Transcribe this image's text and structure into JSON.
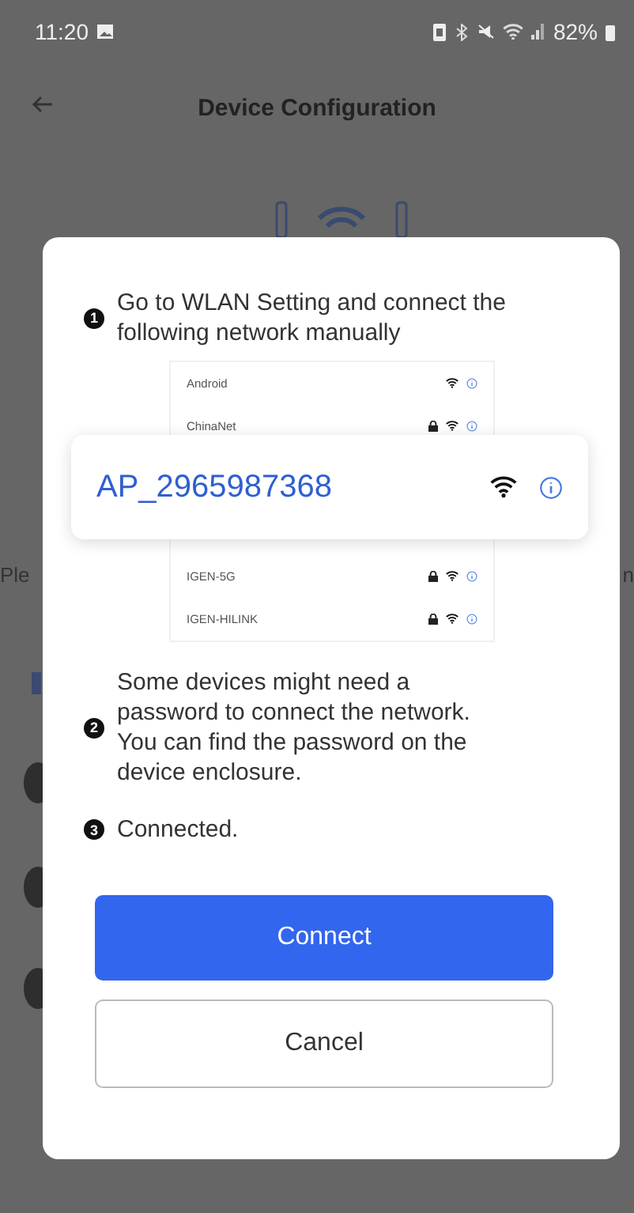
{
  "status_bar": {
    "time": "11:20",
    "battery": "82%"
  },
  "header": {
    "title": "Device Configuration"
  },
  "background_text": {
    "left_edge": "Ple",
    "right_edge": "n"
  },
  "dialog": {
    "steps": [
      {
        "number": "1",
        "text": "Go to WLAN Setting and connect the following network manually",
        "kind": "list"
      },
      {
        "number": "2",
        "text": "Some devices might need a password to connect the network. You can find the password on the device enclosure.",
        "kind": "text"
      },
      {
        "number": "3",
        "text": "Connected.",
        "kind": "text"
      }
    ],
    "networks": [
      {
        "name": "Android",
        "locked": false
      },
      {
        "name": "ChinaNet",
        "locked": true
      },
      {
        "name": "IGEN-5G",
        "locked": true
      },
      {
        "name": "IGEN-HILINK",
        "locked": true
      }
    ],
    "highlight_network": {
      "name": "AP_2965987368"
    },
    "buttons": [
      {
        "label": "Connect",
        "kind": "primary"
      },
      {
        "label": "Cancel",
        "kind": "secondary"
      }
    ]
  }
}
